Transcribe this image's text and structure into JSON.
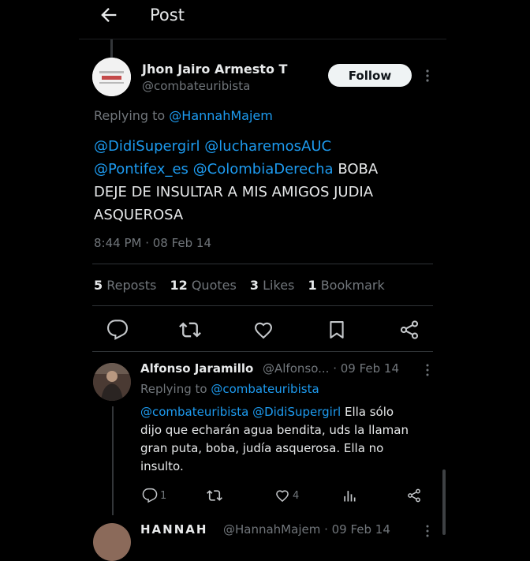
{
  "header": {
    "title": "Post"
  },
  "tweet": {
    "author_name": "Jhon Jairo Armesto T",
    "author_handle": "@combateuribista",
    "follow_label": "Follow",
    "replying_prefix": "Replying to",
    "replying_to": "@HannahMajem",
    "mentions": [
      "@DidiSupergirl",
      "@lucharemosAUC",
      "@Pontifex_es",
      "@ColombiaDerecha"
    ],
    "body_line1": "BOBA",
    "body_line2": "DEJE DE INSULTAR A MIS AMIGOS JUDIA",
    "body_line3": "ASQUEROSA",
    "timestamp": "8:44 PM · 08 Feb 14",
    "stats": {
      "reposts_count": "5",
      "reposts_label": "Reposts",
      "quotes_count": "12",
      "quotes_label": "Quotes",
      "likes_count": "3",
      "likes_label": "Likes",
      "bookmarks_count": "1",
      "bookmarks_label": "Bookmark"
    }
  },
  "reply": {
    "name": "Alfonso Jaramillo",
    "handle_date": "@Alfonso... · 09 Feb 14",
    "replying_prefix": "Replying to",
    "replying_to": "@combateuribista",
    "mention1": "@combateuribista",
    "mention2": "@DidiSupergirl",
    "text_a": "Ella sólo",
    "text_b": "dijo que echarán agua bendita, uds la llaman",
    "text_c": "gran puta, boba, judía asquerosa. Ella no",
    "text_d": "insulto.",
    "reply_count": "1",
    "like_count": "4"
  },
  "next_reply": {
    "name": "HANNAH",
    "handle_date": "@HannahMajem · 09 Feb 14"
  },
  "colors": {
    "accent": "#1d9bf0",
    "muted": "#71767b",
    "text": "#e7e9ea",
    "background": "#000000"
  }
}
